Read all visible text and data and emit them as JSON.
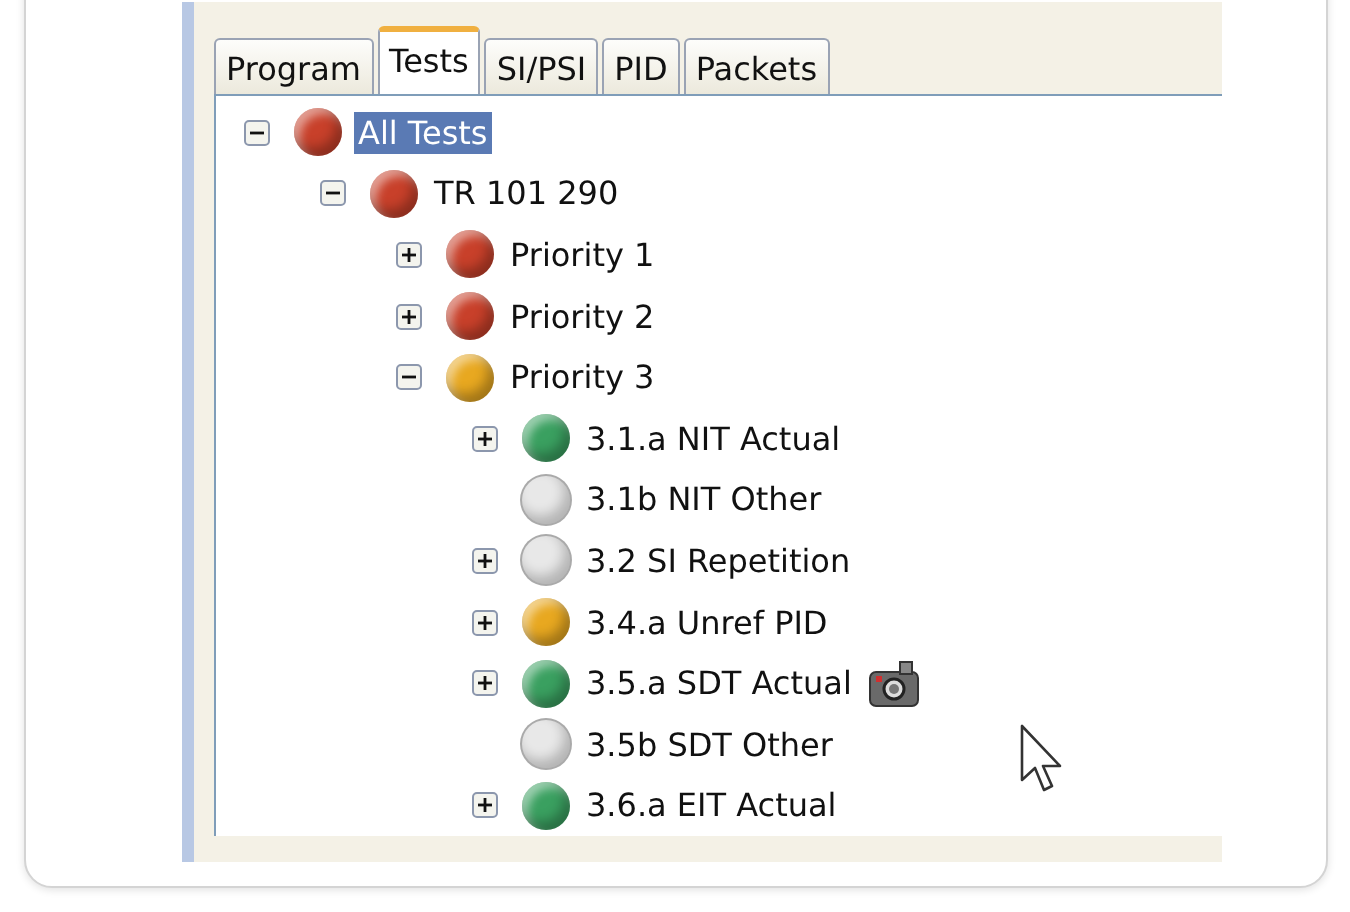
{
  "tabs": [
    {
      "label": "Program",
      "selected": false
    },
    {
      "label": "Tests",
      "selected": true
    },
    {
      "label": "SI/PSI",
      "selected": false
    },
    {
      "label": "PID",
      "selected": false
    },
    {
      "label": "Packets",
      "selected": false
    }
  ],
  "tree": [
    {
      "label": "All Tests",
      "color": "#c8402a",
      "kind": "branch",
      "expanded": true,
      "selected": true,
      "snapshot": false,
      "children": [
        {
          "label": "TR 101 290",
          "color": "#c8402a",
          "kind": "branch",
          "expanded": true,
          "selected": false,
          "snapshot": false,
          "children": [
            {
              "label": "Priority 1",
              "color": "#c8402a",
              "kind": "branch",
              "expanded": false,
              "selected": false,
              "snapshot": false
            },
            {
              "label": "Priority 2",
              "color": "#c8402a",
              "kind": "branch",
              "expanded": false,
              "selected": false,
              "snapshot": false
            },
            {
              "label": "Priority 3",
              "color": "#e8a820",
              "kind": "branch",
              "expanded": true,
              "selected": false,
              "snapshot": false,
              "children": [
                {
                  "label": "3.1.a NIT Actual",
                  "color": "#3aa060",
                  "kind": "branch",
                  "expanded": false,
                  "selected": false,
                  "snapshot": false
                },
                {
                  "label": "3.1b NIT Other",
                  "color": "#e8e8e8",
                  "kind": "leaf",
                  "selected": false,
                  "snapshot": false
                },
                {
                  "label": "3.2 SI Repetition",
                  "color": "#e8e8e8",
                  "kind": "branch",
                  "expanded": false,
                  "selected": false,
                  "snapshot": false
                },
                {
                  "label": "3.4.a Unref PID",
                  "color": "#e8a820",
                  "kind": "branch",
                  "expanded": false,
                  "selected": false,
                  "snapshot": false
                },
                {
                  "label": "3.5.a SDT Actual",
                  "color": "#3aa060",
                  "kind": "branch",
                  "expanded": false,
                  "selected": false,
                  "snapshot": true
                },
                {
                  "label": "3.5b SDT Other",
                  "color": "#e8e8e8",
                  "kind": "leaf",
                  "selected": false,
                  "snapshot": false
                },
                {
                  "label": "3.6.a EIT Actual",
                  "color": "#3aa060",
                  "kind": "branch",
                  "expanded": false,
                  "selected": false,
                  "snapshot": false
                }
              ]
            }
          ]
        }
      ]
    }
  ]
}
